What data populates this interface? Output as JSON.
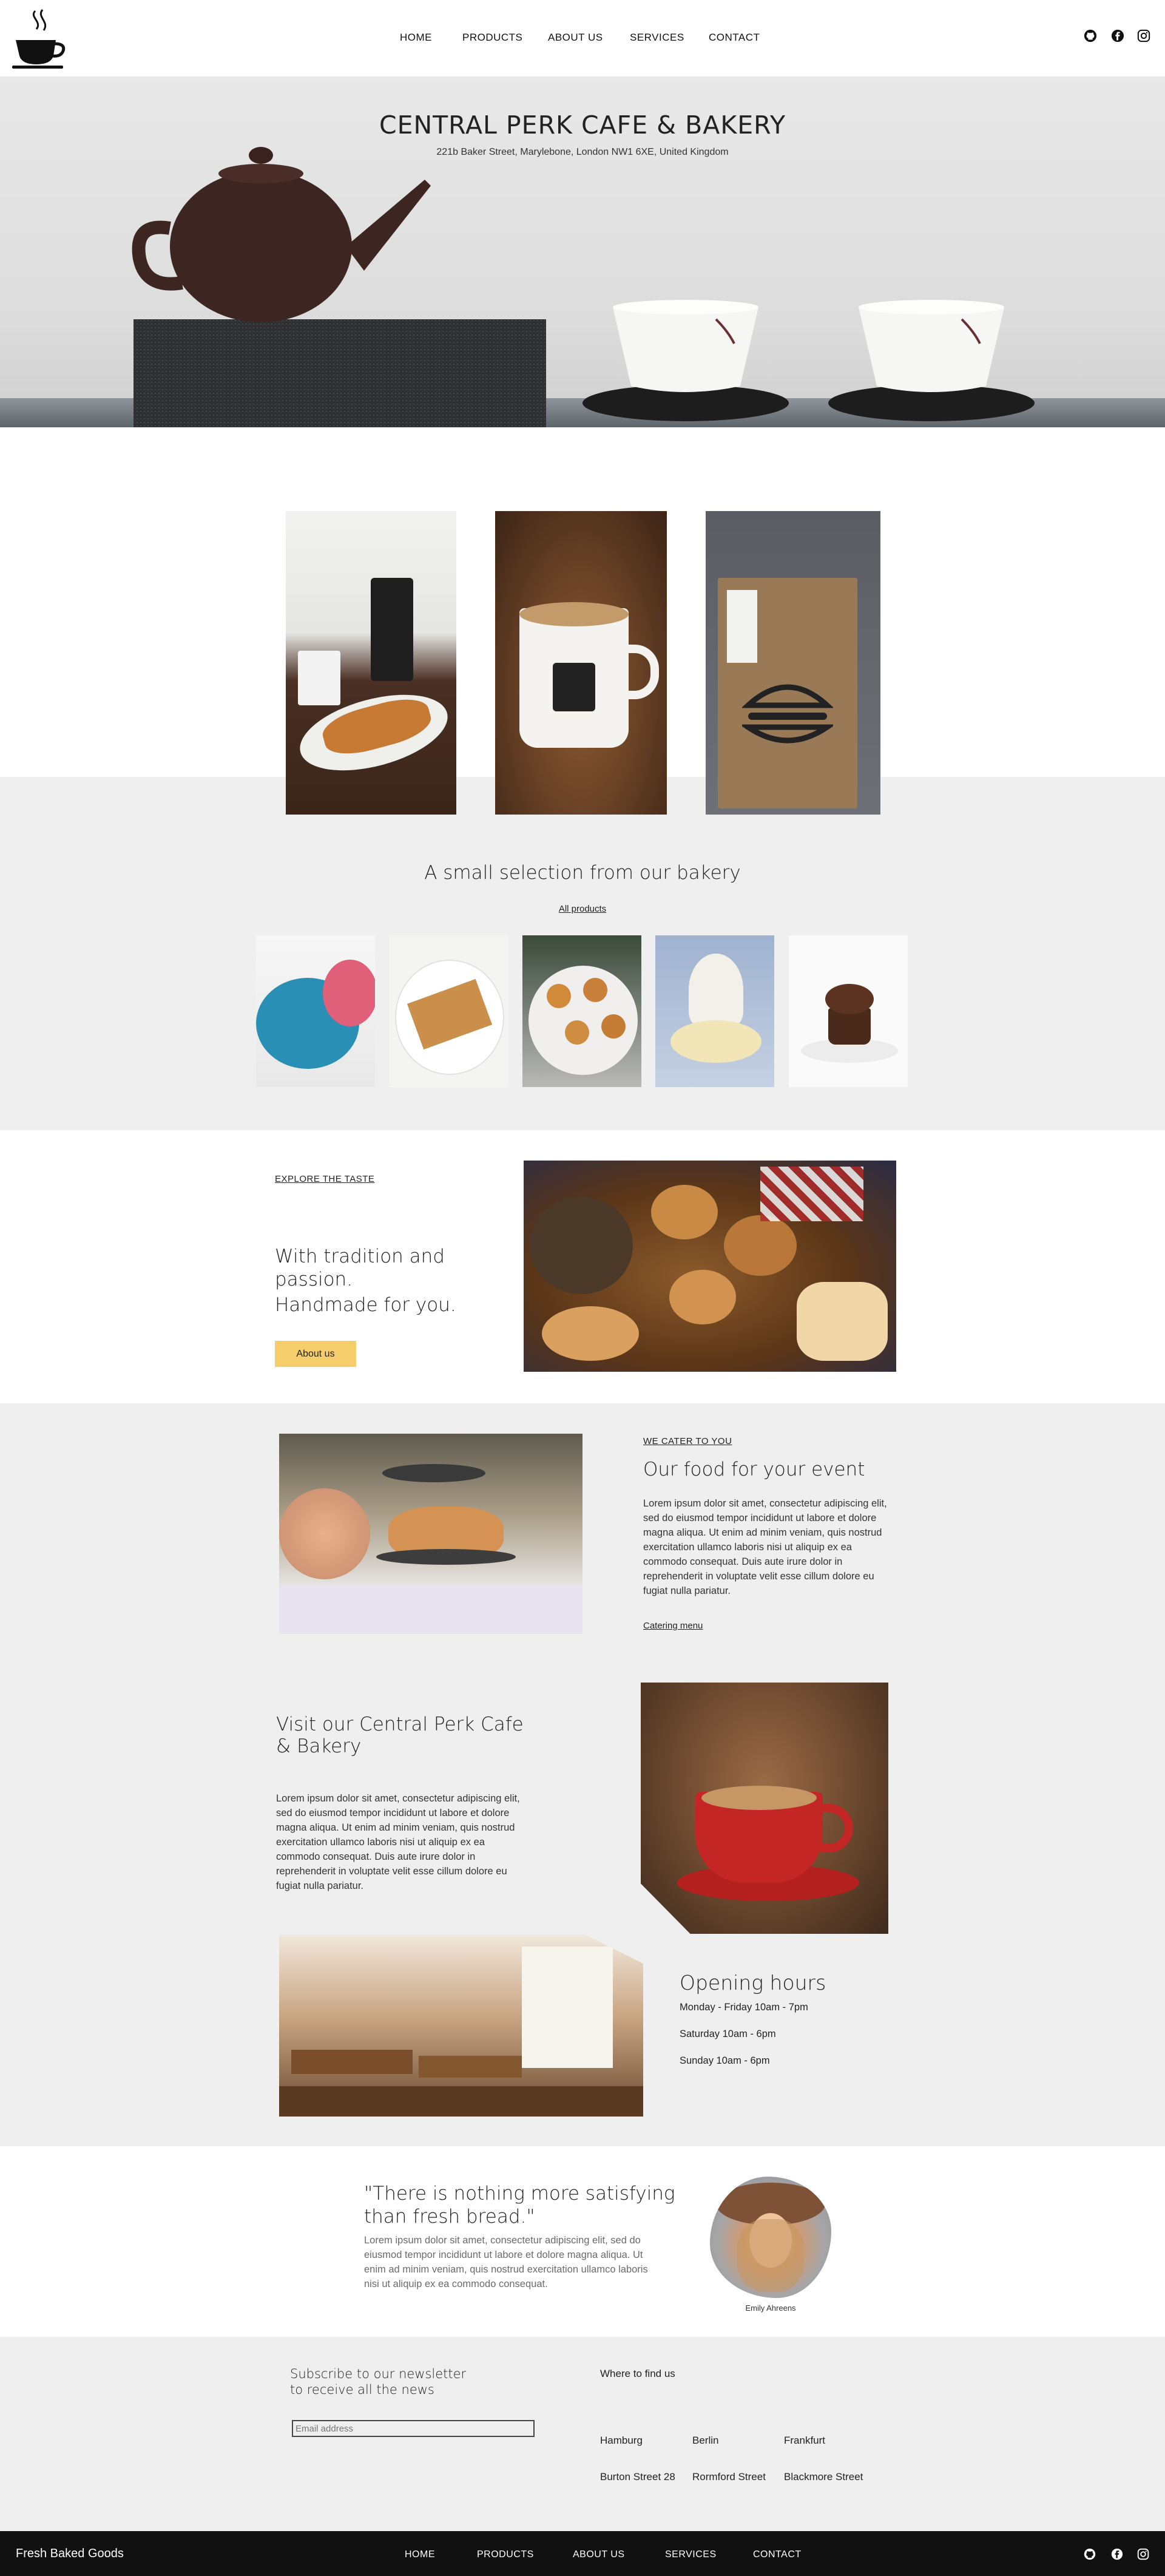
{
  "header": {
    "logo_icon": "coffee-cup-icon",
    "nav": [
      "HOME",
      "PRODUCTS",
      "ABOUT US",
      "SERVICES",
      "CONTACT"
    ],
    "social_icons": [
      "github-icon",
      "facebook-icon",
      "instagram-icon"
    ]
  },
  "hero": {
    "title": "CENTRAL PERK CAFE & BAKERY",
    "address": "221b Baker Street, Marylebone, London NW1 6XE, United Kingdom"
  },
  "bakery": {
    "title": "A small selection from our bakery",
    "link": "All products"
  },
  "about": {
    "eyebrow": "EXPLORE THE TASTE",
    "title_line1": "With tradition and",
    "title_line2": "passion.",
    "title_line3": "Handmade for you.",
    "button": "About us"
  },
  "catering": {
    "eyebrow": "WE CATER TO YOU",
    "title": "Our food for your event",
    "text": "Lorem ipsum dolor sit amet, consectetur adipiscing elit, sed do eiusmod tempor incididunt ut labore et dolore magna aliqua. Ut enim ad minim veniam, quis nostrud exercitation ullamco laboris nisi ut aliquip ex ea commodo consequat. Duis aute irure dolor in reprehenderit in voluptate velit esse cillum dolore eu fugiat nulla pariatur.",
    "link": "Catering menu"
  },
  "visit": {
    "title_line1": "Visit our Central Perk Cafe",
    "title_line2": "& Bakery",
    "text": "Lorem ipsum dolor sit amet, consectetur adipiscing elit, sed do eiusmod tempor incididunt ut labore et dolore magna aliqua. Ut enim ad minim veniam, quis nostrud exercitation ullamco laboris nisi ut aliquip ex ea commodo consequat. Duis aute irure dolor in reprehenderit in voluptate velit esse cillum dolore eu fugiat nulla pariatur."
  },
  "hours": {
    "title": "Opening hours",
    "rows": [
      "Monday - Friday 10am - 7pm",
      "Saturday 10am - 6pm",
      "Sunday 10am - 6pm"
    ]
  },
  "testimonial": {
    "quote_line1": "\"There is nothing more satisfying",
    "quote_line2": "than fresh bread.\"",
    "text": "Lorem ipsum dolor sit amet, consectetur adipiscing elit, sed do eiusmod tempor incididunt ut labore et dolore magna aliqua. Ut enim ad minim veniam, quis nostrud exercitation ullamco laboris nisi ut aliquip ex ea commodo consequat.",
    "name": "Emily Ahreens"
  },
  "newsletter": {
    "title_line1": "Subscribe to our newsletter",
    "title_line2": "to receive all the news",
    "placeholder": "Email address"
  },
  "locations": {
    "title": "Where to find us",
    "cities": [
      "Hamburg",
      "Berlin",
      "Frankfurt"
    ],
    "streets": [
      "Burton Street 28",
      "Rormford Street",
      "Blackmore Street"
    ]
  },
  "footer": {
    "brand": "Fresh Baked Goods",
    "nav": [
      "HOME",
      "PRODUCTS",
      "ABOUT US",
      "SERVICES",
      "CONTACT"
    ]
  },
  "colors": {
    "accent_button": "#f5cd6a",
    "section_grey": "#efefef",
    "footer_bg": "#111111"
  }
}
